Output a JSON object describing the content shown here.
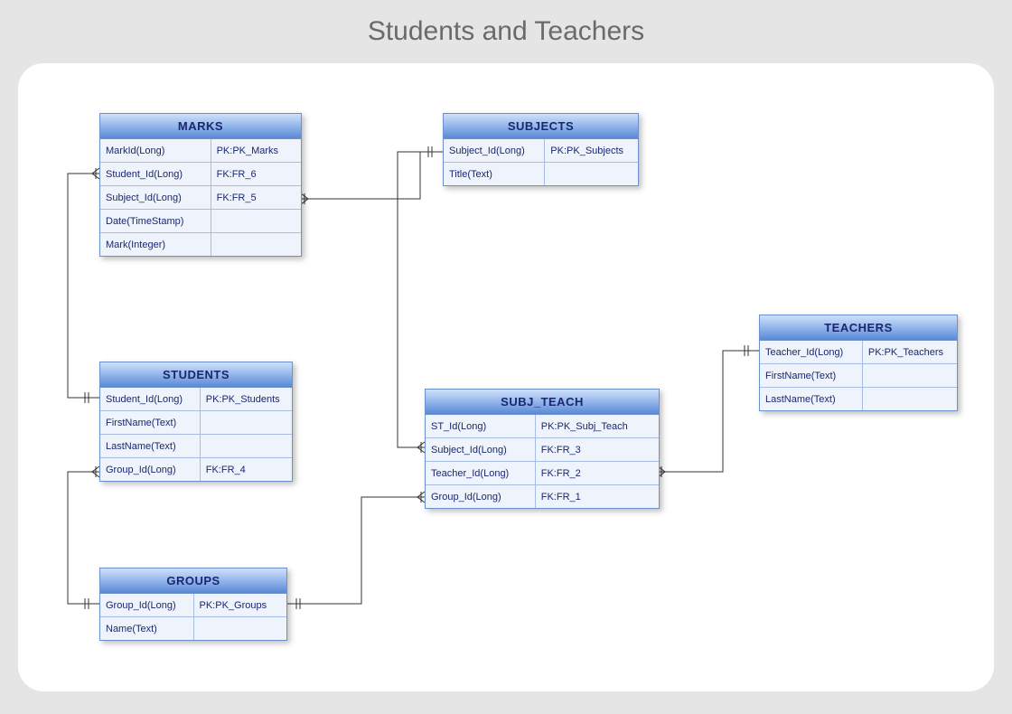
{
  "title": "Students and Teachers",
  "entities": {
    "marks": {
      "name": "MARKS",
      "rows": [
        [
          "MarkId(Long)",
          "PK:PK_Marks"
        ],
        [
          "Student_Id(Long)",
          "FK:FR_6"
        ],
        [
          "Subject_Id(Long)",
          "FK:FR_5"
        ],
        [
          "Date(TimeStamp)",
          ""
        ],
        [
          "Mark(Integer)",
          ""
        ]
      ]
    },
    "subjects": {
      "name": "SUBJECTS",
      "rows": [
        [
          "Subject_Id(Long)",
          "PK:PK_Subjects"
        ],
        [
          "Title(Text)",
          ""
        ]
      ]
    },
    "students": {
      "name": "STUDENTS",
      "rows": [
        [
          "Student_Id(Long)",
          "PK:PK_Students"
        ],
        [
          "FirstName(Text)",
          ""
        ],
        [
          "LastName(Text)",
          ""
        ],
        [
          "Group_Id(Long)",
          "FK:FR_4"
        ]
      ]
    },
    "subj_teach": {
      "name": "SUBJ_TEACH",
      "rows": [
        [
          "ST_Id(Long)",
          "PK:PK_Subj_Teach"
        ],
        [
          "Subject_Id(Long)",
          "FK:FR_3"
        ],
        [
          "Teacher_Id(Long)",
          "FK:FR_2"
        ],
        [
          "Group_Id(Long)",
          "FK:FR_1"
        ]
      ]
    },
    "teachers": {
      "name": "TEACHERS",
      "rows": [
        [
          "Teacher_Id(Long)",
          "PK:PK_Teachers"
        ],
        [
          "FirstName(Text)",
          ""
        ],
        [
          "LastName(Text)",
          ""
        ]
      ]
    },
    "groups": {
      "name": "GROUPS",
      "rows": [
        [
          "Group_Id(Long)",
          "PK:PK_Groups"
        ],
        [
          "Name(Text)",
          ""
        ]
      ]
    }
  },
  "relationships": [
    {
      "from": "MARKS.Student_Id",
      "to": "STUDENTS.Student_Id",
      "fk": "FR_6"
    },
    {
      "from": "MARKS.Subject_Id",
      "to": "SUBJECTS.Subject_Id",
      "fk": "FR_5"
    },
    {
      "from": "STUDENTS.Group_Id",
      "to": "GROUPS.Group_Id",
      "fk": "FR_4"
    },
    {
      "from": "SUBJ_TEACH.Subject_Id",
      "to": "SUBJECTS.Subject_Id",
      "fk": "FR_3"
    },
    {
      "from": "SUBJ_TEACH.Teacher_Id",
      "to": "TEACHERS.Teacher_Id",
      "fk": "FR_2"
    },
    {
      "from": "SUBJ_TEACH.Group_Id",
      "to": "GROUPS.Group_Id",
      "fk": "FR_1"
    }
  ]
}
